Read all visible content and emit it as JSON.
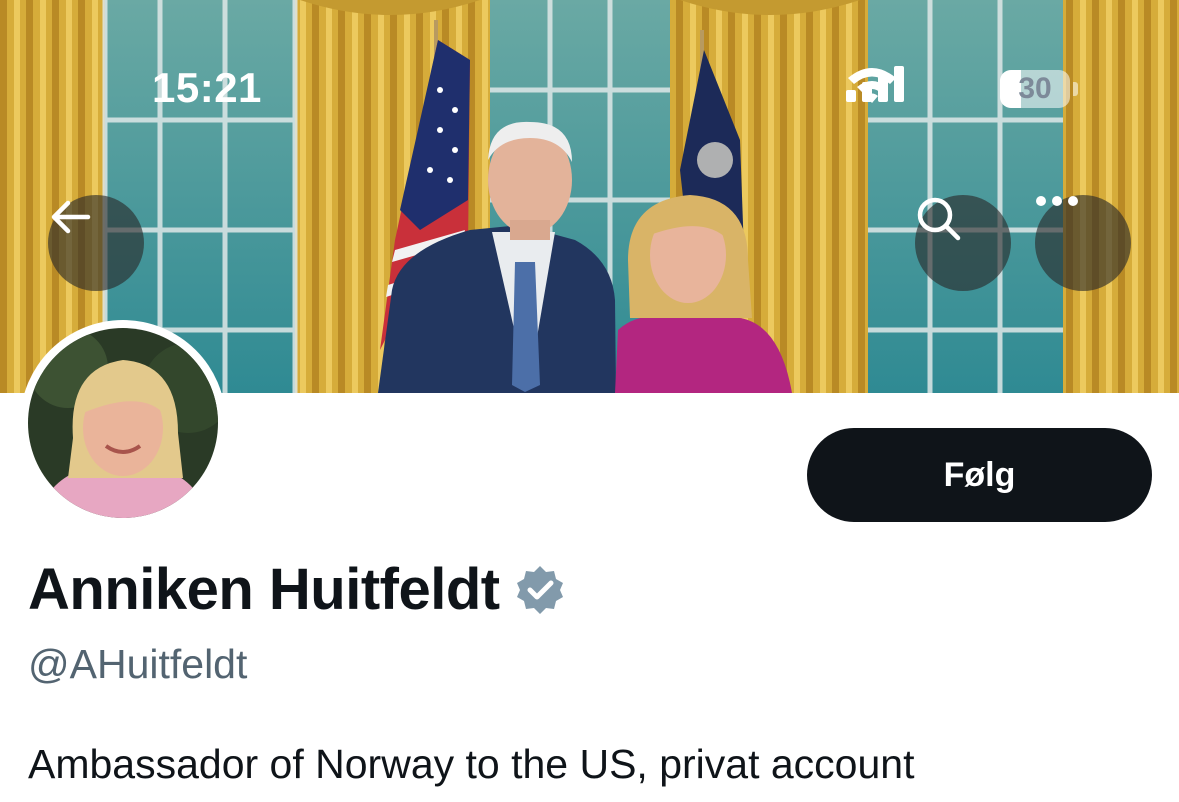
{
  "status_bar": {
    "time": "15:21",
    "battery_level": "30",
    "battery_fraction": 0.3
  },
  "nav": {
    "back_icon": "arrow-left-icon",
    "search_icon": "search-icon",
    "more_icon": "more-horizontal-icon"
  },
  "profile": {
    "display_name": "Anniken Huitfeldt",
    "handle": "@AHuitfeldt",
    "bio": "Ambassador of Norway to the US, privat account",
    "verified": true,
    "verified_color": "#829aab"
  },
  "actions": {
    "follow_label": "Følg"
  },
  "colors": {
    "follow_button_bg": "#0f1419",
    "handle_text": "#536471",
    "primary_text": "#0f1419"
  }
}
